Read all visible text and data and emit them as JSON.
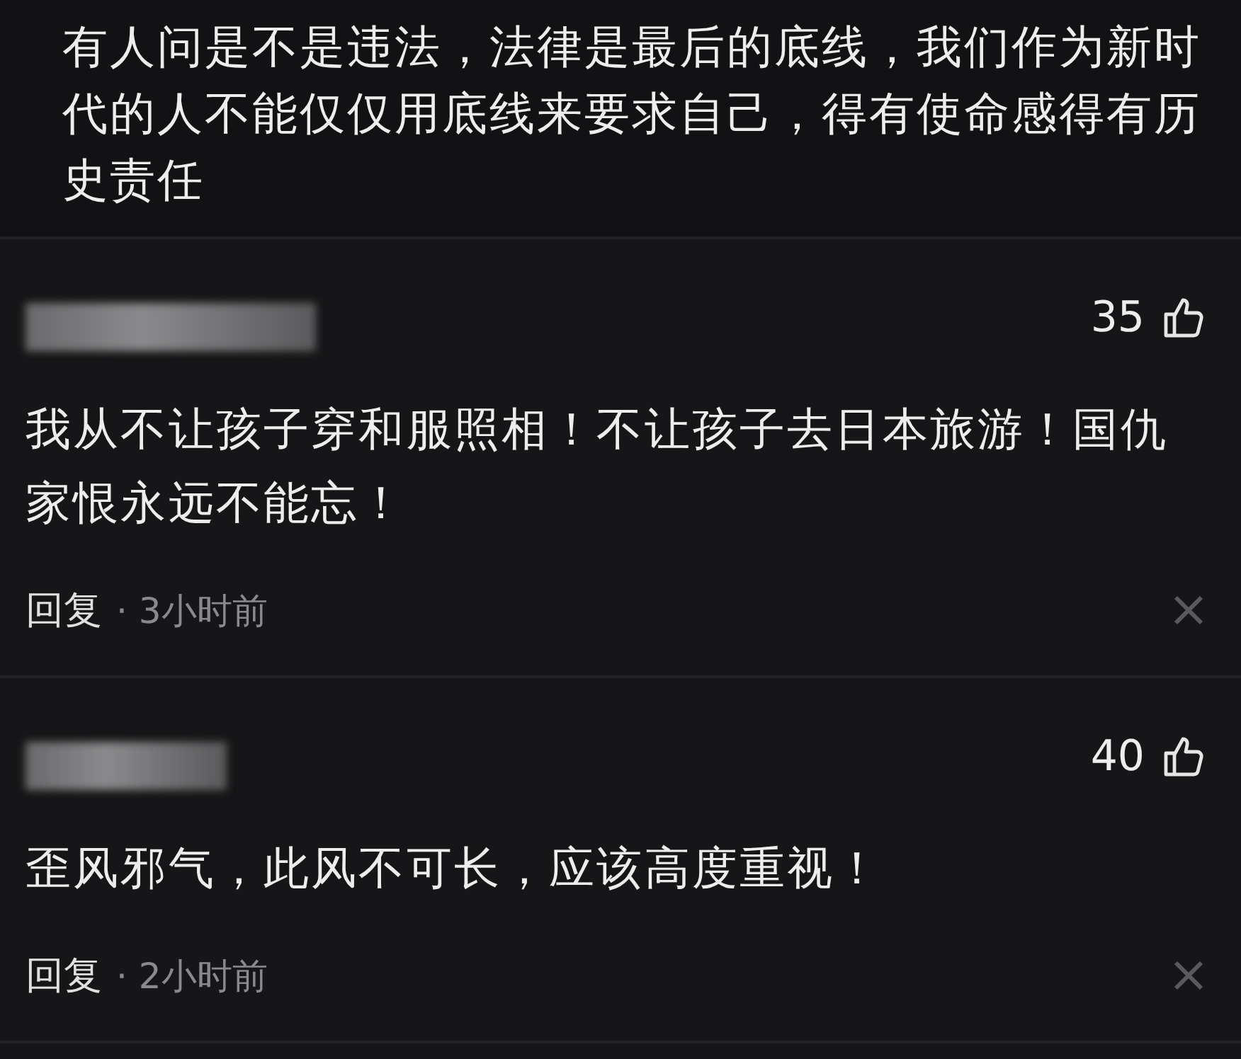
{
  "previous_comment": {
    "text": "有人问是不是违法，法律是最后的底线，我们作为新时代的人不能仅仅用底线来要求自己，得有使命感得有历史责任"
  },
  "comments": [
    {
      "likes": "35",
      "text": "我从不让孩子穿和服照相！不让孩子去日本旅游！国仇家恨永远不能忘！",
      "reply": "回复",
      "time": "· 3小时前"
    },
    {
      "likes": "40",
      "text": "歪风邪气，此风不可长，应该高度重视！",
      "reply": "回复",
      "time": "· 2小时前"
    }
  ]
}
